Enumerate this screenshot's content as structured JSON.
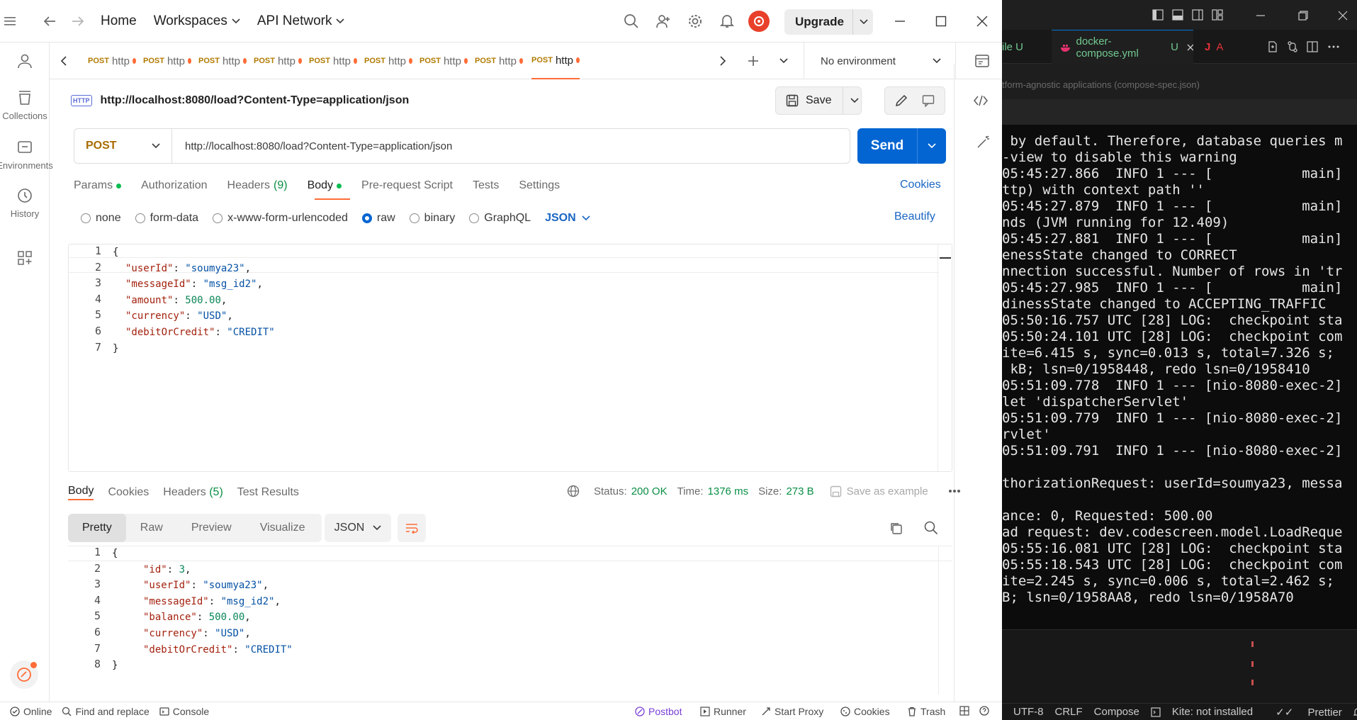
{
  "topbar": {
    "home": "Home",
    "workspaces": "Workspaces",
    "api_network": "API Network",
    "upgrade": "Upgrade"
  },
  "sidebar": {
    "items": [
      {
        "label": ""
      },
      {
        "label": "Collections"
      },
      {
        "label": "Environments"
      },
      {
        "label": "History"
      }
    ]
  },
  "tabs": {
    "method": "POST",
    "label": "http",
    "environment": "No environment"
  },
  "request": {
    "title": "http://localhost:8080/load?Content-Type=application/json",
    "http_badge": "HTTP",
    "save": "Save",
    "method": "POST",
    "url": "http://localhost:8080/load?Content-Type=application/json",
    "send": "Send",
    "tabs": {
      "params": "Params",
      "authorization": "Authorization",
      "headers": "Headers",
      "headers_count": "(9)",
      "body": "Body",
      "prerequest": "Pre-request Script",
      "tests": "Tests",
      "settings": "Settings"
    },
    "cookies": "Cookies",
    "body_types": {
      "none": "none",
      "form_data": "form-data",
      "urlencoded": "x-www-form-urlencoded",
      "raw": "raw",
      "binary": "binary",
      "graphql": "GraphQL",
      "format": "JSON"
    },
    "beautify": "Beautify",
    "body_lines": [
      {
        "n": "1",
        "text": "{"
      },
      {
        "n": "2",
        "key": "\"userId\"",
        "value": "\"soumya23\"",
        "kind": "str",
        "end": ","
      },
      {
        "n": "3",
        "key": "\"messageId\"",
        "value": "\"msg_id2\"",
        "kind": "str",
        "end": ","
      },
      {
        "n": "4",
        "key": "\"amount\"",
        "value": "500.00",
        "kind": "num",
        "end": ","
      },
      {
        "n": "5",
        "key": "\"currency\"",
        "value": "\"USD\"",
        "kind": "str",
        "end": ","
      },
      {
        "n": "6",
        "key": "\"debitOrCredit\"",
        "value": "\"CREDIT\"",
        "kind": "str",
        "end": ""
      },
      {
        "n": "7",
        "text": "}"
      }
    ]
  },
  "response": {
    "tabs": {
      "body": "Body",
      "cookies": "Cookies",
      "headers": "Headers",
      "headers_count": "(5)",
      "test_results": "Test Results"
    },
    "status_label": "Status:",
    "status_value": "200 OK",
    "time_label": "Time:",
    "time_value": "1376 ms",
    "size_label": "Size:",
    "size_value": "273 B",
    "save_example": "Save as example",
    "views": {
      "pretty": "Pretty",
      "raw": "Raw",
      "preview": "Preview",
      "visualize": "Visualize"
    },
    "format": "JSON",
    "body_lines": [
      {
        "n": "1",
        "text": "{"
      },
      {
        "n": "2",
        "key": "\"id\"",
        "value": "3",
        "kind": "num",
        "end": ","
      },
      {
        "n": "3",
        "key": "\"userId\"",
        "value": "\"soumya23\"",
        "kind": "str",
        "end": ","
      },
      {
        "n": "4",
        "key": "\"messageId\"",
        "value": "\"msg_id2\"",
        "kind": "str",
        "end": ","
      },
      {
        "n": "5",
        "key": "\"balance\"",
        "value": "500.00",
        "kind": "num",
        "end": ","
      },
      {
        "n": "6",
        "key": "\"currency\"",
        "value": "\"USD\"",
        "kind": "str",
        "end": ","
      },
      {
        "n": "7",
        "key": "\"debitOrCredit\"",
        "value": "\"CREDIT\"",
        "kind": "str",
        "end": ""
      },
      {
        "n": "8",
        "text": "}"
      }
    ]
  },
  "statusbar": {
    "online": "Online",
    "find_replace": "Find and replace",
    "console": "Console",
    "postbot": "Postbot",
    "runner": "Runner",
    "start_proxy": "Start Proxy",
    "cookies": "Cookies",
    "trash": "Trash"
  },
  "vscode": {
    "tab_partial": "ile U",
    "tab_compose": "docker-compose.yml",
    "tab_compose_state": "U",
    "tab_other": "A",
    "breadcrumb": "tform-agnostic applications (compose-spec.json)",
    "terminal_lines": [
      " by default. Therefore, database queries m",
      "-view to disable this warning",
      "05:45:27.866  INFO 1 --- [           main]",
      "ttp) with context path ''",
      "05:45:27.879  INFO 1 --- [           main]",
      "nds (JVM running for 12.409)",
      "05:45:27.881  INFO 1 --- [           main]",
      "enessState changed to CORRECT",
      "nnection successful. Number of rows in 'tr",
      "05:45:27.985  INFO 1 --- [           main]",
      "dinessState changed to ACCEPTING_TRAFFIC",
      "05:50:16.757 UTC [28] LOG:  checkpoint sta",
      "05:50:24.101 UTC [28] LOG:  checkpoint com",
      "ite=6.415 s, sync=0.013 s, total=7.326 s;",
      " kB; lsn=0/1958448, redo lsn=0/1958410",
      "05:51:09.778  INFO 1 --- [nio-8080-exec-2]",
      "let 'dispatcherServlet'",
      "05:51:09.779  INFO 1 --- [nio-8080-exec-2]",
      "rvlet'",
      "05:51:09.791  INFO 1 --- [nio-8080-exec-2]",
      "",
      "thorizationRequest: userId=soumya23, messa",
      "",
      "ance: 0, Requested: 500.00",
      "ad request: dev.codescreen.model.LoadReque",
      "05:55:16.081 UTC [28] LOG:  checkpoint sta",
      "05:55:18.543 UTC [28] LOG:  checkpoint com",
      "ite=2.245 s, sync=0.006 s, total=2.462 s;",
      "B; lsn=0/1958AA8, redo lsn=0/1958A70"
    ],
    "status": {
      "encoding": "UTF-8",
      "eol": "CRLF",
      "language": "Compose",
      "kite": "Kite: not installed",
      "prettier": "Prettier"
    }
  }
}
